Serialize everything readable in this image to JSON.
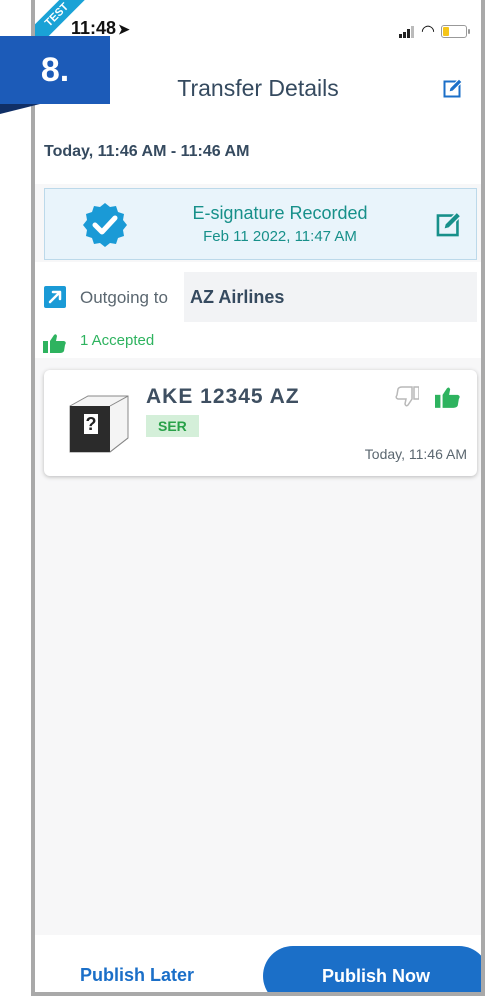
{
  "step_label": "8.",
  "status": {
    "time": "11:48",
    "ribbon": "TEST"
  },
  "header": {
    "title": "Transfer Details"
  },
  "transfer": {
    "datetime_range": "Today, 11:46 AM - 11:46 AM"
  },
  "esignature": {
    "title": "E-signature Recorded",
    "date": "Feb 11 2022, 11:47 AM"
  },
  "outgoing": {
    "label": "Outgoing to",
    "value": "AZ Airlines"
  },
  "accepted": {
    "text": "1 Accepted"
  },
  "card": {
    "title": "AKE 12345 AZ",
    "badge": "SER",
    "time": "Today, 11:46 AM"
  },
  "footer": {
    "publish_later": "Publish Later",
    "publish_now": "Publish Now"
  },
  "colors": {
    "primary": "#1b6fc8",
    "teal": "#17908a",
    "green": "#2eb35f",
    "step_badge": "#1c5bb8"
  },
  "icons": [
    "location-arrow-icon",
    "signal-icon",
    "wifi-icon",
    "battery-icon",
    "edit-icon",
    "verified-badge-icon",
    "outgoing-arrow-icon",
    "thumbs-up-icon",
    "thumbs-down-icon",
    "uld-container-icon"
  ]
}
